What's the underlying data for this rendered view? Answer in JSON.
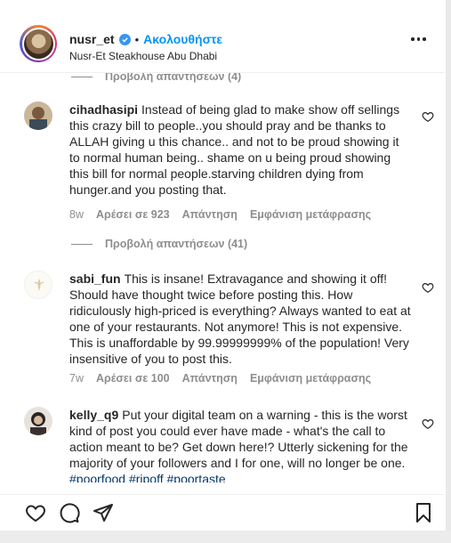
{
  "header": {
    "username": "nusr_et",
    "separator": "•",
    "follow_label": "Ακολουθήστε",
    "location": "Nusr-Et Steakhouse Abu Dhabi",
    "accent_color": "#0095f6",
    "verified_color": "#3897f0"
  },
  "replies_top": {
    "label": "Προβολή απαντήσεων (4)"
  },
  "comments": [
    {
      "user": "cihadhasipi",
      "text": "Instead of being glad to make show off sellings this crazy bill to people..you should pray and be thanks to ALLAH giving u this chance.. and not to be proud showing it to normal human being.. shame on u being proud showing this bill for normal people.starving children dying from hunger.and you posting that.",
      "time": "8w",
      "likes": "Αρέσει σε 923",
      "reply": "Απάντηση",
      "translate": "Εμφάνιση μετάφρασης",
      "replies": "Προβολή απαντήσεων (41)"
    },
    {
      "user": "sabi_fun",
      "text": "This is insane! Extravagance and showing it off! Should have thought twice before posting this. How ridiculously high-priced is everything? Always wanted to eat at one of your restaurants. Not anymore! This is not expensive. This is unaffordable by 99.99999999% of the population! Very insensitive of you to post this.",
      "time": "7w",
      "likes": "Αρέσει σε 100",
      "reply": "Απάντηση",
      "translate": "Εμφάνιση μετάφρασης"
    },
    {
      "user": "kelly_q9",
      "text": "Put your digital team on a warning - this is the worst kind of post you could ever have made - what's the call to action meant to be? Get down here!? Utterly sickening for the majority of your followers and I for one, will no longer be one.",
      "hashtags": "#poorfood #ripoff #poortaste"
    }
  ],
  "actions": {
    "like_icon": "heart-icon",
    "comment_icon": "comment-icon",
    "share_icon": "paper-plane-icon",
    "save_icon": "bookmark-icon"
  }
}
